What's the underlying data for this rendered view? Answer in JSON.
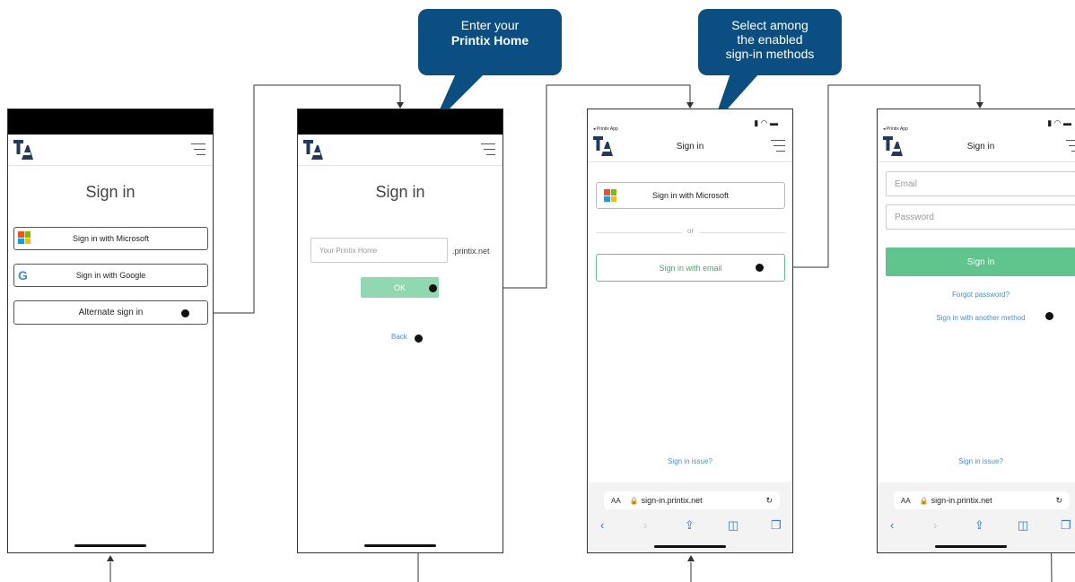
{
  "callouts": {
    "printix_home_line1": "Enter your",
    "printix_home_line2": "Printix Home",
    "methods_line1": "Select among",
    "methods_line2": "the enabled",
    "methods_line3": "sign-in methods"
  },
  "screen1": {
    "title": "Sign in",
    "microsoft_label": "Sign in with Microsoft",
    "google_label": "Sign in with Google",
    "alternate_label": "Alternate sign in"
  },
  "screen2": {
    "title": "Sign in",
    "home_placeholder": "Your Printix Home",
    "domain_suffix": ".printix.net",
    "ok_label": "OK",
    "back_label": "Back"
  },
  "screen3": {
    "back_app": "◂ Printix App",
    "title": "Sign in",
    "microsoft_label": "Sign in with Microsoft",
    "or_label": "or",
    "email_label": "Sign in with email",
    "issue_label": "Sign in issue?",
    "url": "sign-in.printix.net",
    "aa": "AA"
  },
  "screen4": {
    "back_app": "◂ Printix App",
    "title": "Sign in",
    "email_placeholder": "Email",
    "password_placeholder": "Password",
    "signin_label": "Sign in",
    "forgot_label": "Forgot password?",
    "another_method_label": "Sign in with another method",
    "issue_label": "Sign in issue?",
    "url": "sign-in.printix.net",
    "aa": "AA"
  },
  "colors": {
    "callout_bg": "#0b4f82",
    "ok_green": "#8fd8b0",
    "email_green": "#5fc58c",
    "link_blue": "#4a8fd0"
  }
}
